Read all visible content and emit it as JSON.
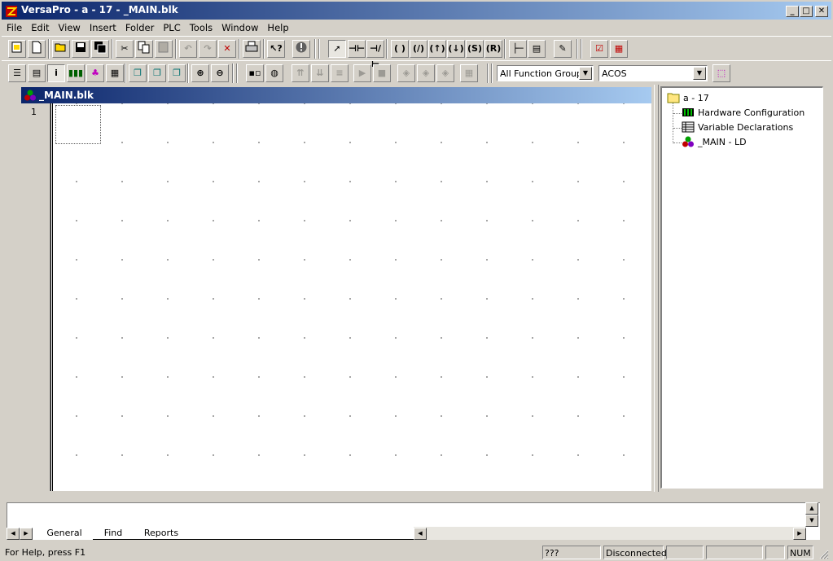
{
  "window": {
    "title": "VersaPro - a - 17 - _MAIN.blk",
    "min_glyph": "_",
    "max_glyph": "□",
    "close_glyph": "✕"
  },
  "menu": [
    "File",
    "Edit",
    "View",
    "Insert",
    "Folder",
    "PLC",
    "Tools",
    "Window",
    "Help"
  ],
  "toolbar1": {
    "icons": [
      "new-folder-icon",
      "new-file-icon",
      "open-icon",
      "save-icon",
      "save-all-icon",
      "cut-icon",
      "copy-icon",
      "paste-icon",
      "undo-icon",
      "redo-icon",
      "delete-icon",
      "print-icon",
      "context-help-icon",
      "stop-icon",
      "select-pointer-icon",
      "no-contact-icon",
      "nc-contact-icon",
      "coil-icon",
      "negated-coil-icon",
      "positive-coil-icon",
      "negative-coil-icon",
      "set-coil-icon",
      "reset-coil-icon",
      "horizontal-wire-icon",
      "function-block-icon",
      "properties-icon",
      "check-icon",
      "report-icon"
    ]
  },
  "toolbar2": {
    "function_groups": "All Function Groups",
    "function_name": "ACOS"
  },
  "child": {
    "title": "_MAIN.blk",
    "rung_number": "1"
  },
  "tree": {
    "root": "a - 17",
    "items": [
      {
        "label": "Hardware Configuration",
        "icon": "hardware-config-icon"
      },
      {
        "label": "Variable Declarations",
        "icon": "variable-table-icon"
      },
      {
        "label": "_MAIN - LD",
        "icon": "ladder-block-icon"
      }
    ]
  },
  "output_tabs": [
    "General",
    "Find",
    "Reports"
  ],
  "status": {
    "help": "For Help, press F1",
    "pane1": "???",
    "pane2": "Disconnected",
    "pane3": "",
    "pane4": "",
    "pane5": "",
    "num": "NUM"
  }
}
